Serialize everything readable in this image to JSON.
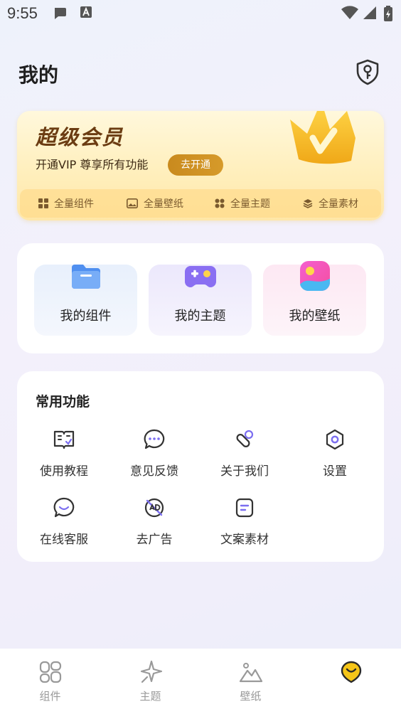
{
  "status_bar": {
    "time": "9:55"
  },
  "header": {
    "title": "我的"
  },
  "vip": {
    "title": "超级会员",
    "subtitle": "开通VIP 尊享所有功能",
    "open_button": "去开通",
    "features": [
      "全量组件",
      "全量壁纸",
      "全量主题",
      "全量素材"
    ]
  },
  "mine": {
    "items": [
      {
        "label": "我的组件",
        "icon": "folder-icon"
      },
      {
        "label": "我的主题",
        "icon": "gamepad-icon"
      },
      {
        "label": "我的壁纸",
        "icon": "picture-icon"
      }
    ]
  },
  "functions": {
    "title": "常用功能",
    "items": [
      {
        "label": "使用教程",
        "icon": "book-icon"
      },
      {
        "label": "意见反馈",
        "icon": "chat-icon"
      },
      {
        "label": "关于我们",
        "icon": "link-icon"
      },
      {
        "label": "设置",
        "icon": "gear-icon"
      },
      {
        "label": "在线客服",
        "icon": "customer-service-icon"
      },
      {
        "label": "去广告",
        "icon": "no-ads-icon"
      },
      {
        "label": "文案素材",
        "icon": "document-icon"
      }
    ]
  },
  "tabbar": {
    "tabs": [
      {
        "label": "组件",
        "icon": "widgets-icon"
      },
      {
        "label": "主题",
        "icon": "sparkle-icon"
      },
      {
        "label": "壁纸",
        "icon": "mountain-icon"
      },
      {
        "label": "",
        "icon": "profile-icon",
        "active": true
      }
    ]
  },
  "colors": {
    "accent": "#7b6ef0",
    "vip_gold": "#c98a1e",
    "active_tab": "#f5c518"
  }
}
